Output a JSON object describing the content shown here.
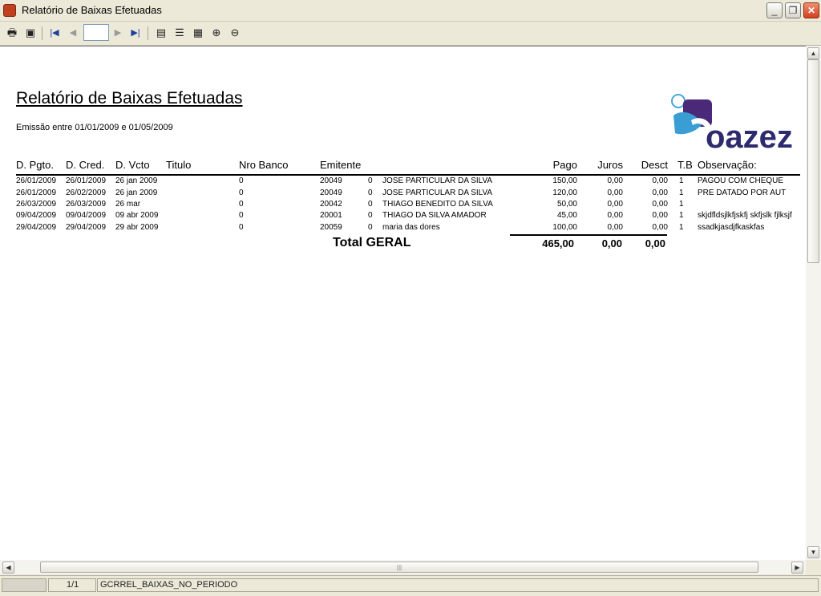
{
  "window": {
    "title": "Relatório de Baixas Efetuadas"
  },
  "toolbar": {
    "page_value": ""
  },
  "report": {
    "title": "Relatório de Baixas Efetuadas",
    "emission": "Emissão entre 01/01/2009 e 01/05/2009",
    "logo_text": "oazez",
    "columns": {
      "d_pgto": "D. Pgto.",
      "d_cred": "D. Cred.",
      "d_vcto": "D. Vcto",
      "titulo": "Titulo",
      "nro_banco": "Nro Banco",
      "emitente": "Emitente",
      "pago": "Pago",
      "juros": "Juros",
      "desct": "Desct",
      "tb": "T.B",
      "observacao": "Observação:"
    },
    "rows": [
      {
        "d_pgto": "26/01/2009",
        "d_cred": "26/01/2009",
        "d_vcto": "26 jan 2009",
        "banco": "0",
        "codigo": "20049",
        "zero": "0",
        "nome": "JOSE PARTICULAR DA SILVA",
        "pago": "150,00",
        "juros": "0,00",
        "desct": "0,00",
        "tb": "1",
        "obs": "PAGOU COM CHEQUE"
      },
      {
        "d_pgto": "26/01/2009",
        "d_cred": "26/02/2009",
        "d_vcto": "26 jan 2009",
        "banco": "0",
        "codigo": "20049",
        "zero": "0",
        "nome": "JOSE PARTICULAR DA SILVA",
        "pago": "120,00",
        "juros": "0,00",
        "desct": "0,00",
        "tb": "1",
        "obs": "PRE DATADO POR AUT"
      },
      {
        "d_pgto": "26/03/2009",
        "d_cred": "26/03/2009",
        "d_vcto": "26 mar",
        "banco": "0",
        "codigo": "20042",
        "zero": "0",
        "nome": "THIAGO BENEDITO DA SILVA",
        "pago": "50,00",
        "juros": "0,00",
        "desct": "0,00",
        "tb": "1",
        "obs": ""
      },
      {
        "d_pgto": "09/04/2009",
        "d_cred": "09/04/2009",
        "d_vcto": "09 abr 2009",
        "banco": "0",
        "codigo": "20001",
        "zero": "0",
        "nome": "THIAGO DA SILVA AMADOR",
        "pago": "45,00",
        "juros": "0,00",
        "desct": "0,00",
        "tb": "1",
        "obs": "skjdfldsjlkfjskfj skfjslk fjlksjf"
      },
      {
        "d_pgto": "29/04/2009",
        "d_cred": "29/04/2009",
        "d_vcto": "29 abr 2009",
        "banco": "0",
        "codigo": "20059",
        "zero": "0",
        "nome": "maria das dores",
        "pago": "100,00",
        "juros": "0,00",
        "desct": "0,00",
        "tb": "1",
        "obs": "ssadkjasdjfkaskfas"
      }
    ],
    "total": {
      "label": "Total GERAL",
      "pago": "465,00",
      "juros": "0,00",
      "desct": "0,00"
    }
  },
  "status": {
    "panel1": "",
    "page_count": "1/1",
    "report_name": "GCRREL_BAIXAS_NO_PERIODO"
  }
}
